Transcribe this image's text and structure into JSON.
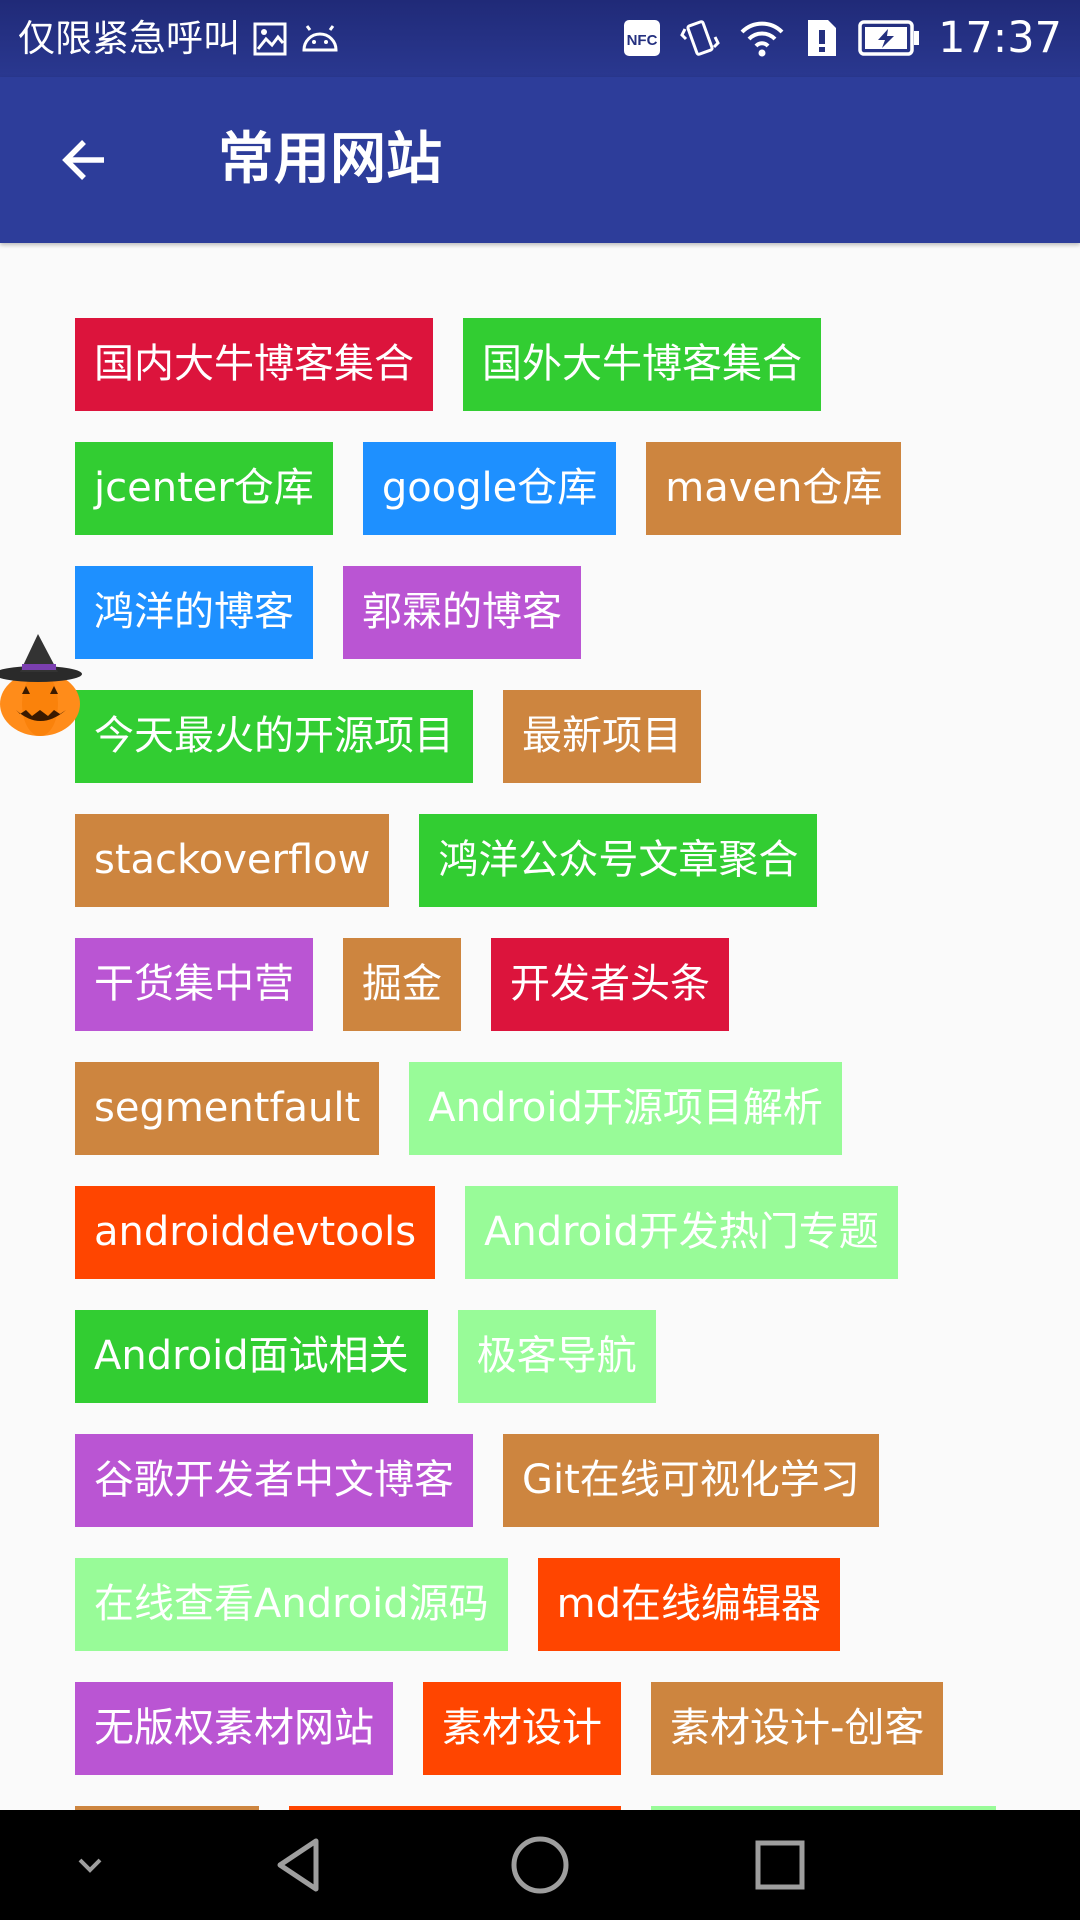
{
  "status_bar": {
    "carrier_text": "仅限紧急呼叫",
    "nfc_label": "NFC",
    "time": "17:37"
  },
  "app_bar": {
    "title": "常用网站"
  },
  "tags": [
    {
      "label": "国内大牛博客集合",
      "color": "#dc143c"
    },
    {
      "label": "国外大牛博客集合",
      "color": "#32cd32"
    },
    {
      "label": "jcenter仓库",
      "color": "#32cd32"
    },
    {
      "label": "google仓库",
      "color": "#1e90ff"
    },
    {
      "label": "maven仓库",
      "color": "#cd853f"
    },
    {
      "label": "鸿洋的博客",
      "color": "#1e90ff"
    },
    {
      "label": "郭霖的博客",
      "color": "#ba55d3"
    },
    {
      "label": "今天最火的开源项目",
      "color": "#32cd32"
    },
    {
      "label": "最新项目",
      "color": "#cd853f"
    },
    {
      "label": "stackoverflow",
      "color": "#cd853f"
    },
    {
      "label": "鸿洋公众号文章聚合",
      "color": "#32cd32"
    },
    {
      "label": "干货集中营",
      "color": "#ba55d3"
    },
    {
      "label": "掘金",
      "color": "#cd853f"
    },
    {
      "label": "开发者头条",
      "color": "#dc143c"
    },
    {
      "label": "segmentfault",
      "color": "#cd853f"
    },
    {
      "label": "Android开源项目解析",
      "color": "#98fb98"
    },
    {
      "label": "androiddevtools",
      "color": "#ff4500"
    },
    {
      "label": "Android开发热门专题",
      "color": "#98fb98"
    },
    {
      "label": "Android面试相关",
      "color": "#32cd32"
    },
    {
      "label": "极客导航",
      "color": "#98fb98"
    },
    {
      "label": "谷歌开发者中文博客",
      "color": "#ba55d3"
    },
    {
      "label": "Git在线可视化学习",
      "color": "#cd853f"
    },
    {
      "label": "在线查看Android源码",
      "color": "#98fb98"
    },
    {
      "label": "md在线编辑器",
      "color": "#ff4500"
    },
    {
      "label": "无版权素材网站",
      "color": "#ba55d3"
    },
    {
      "label": "素材设计",
      "color": "#ff4500"
    },
    {
      "label": "素材设计-创客",
      "color": "#cd853f"
    },
    {
      "label": "",
      "color": "#cd853f"
    },
    {
      "label": "",
      "color": "#ff4500"
    },
    {
      "label": "",
      "color": "#98fb98"
    }
  ],
  "icons": {
    "back": "arrow-left-icon",
    "pumpkin": "pumpkin-icon",
    "nav": [
      "chevron-down-icon",
      "back-triangle-icon",
      "home-circle-icon",
      "recents-square-icon"
    ]
  },
  "colors": {
    "status_bar": "#202a78",
    "app_bar": "#2d3d9a",
    "background": "#fafafa",
    "nav_bar": "#000000"
  }
}
